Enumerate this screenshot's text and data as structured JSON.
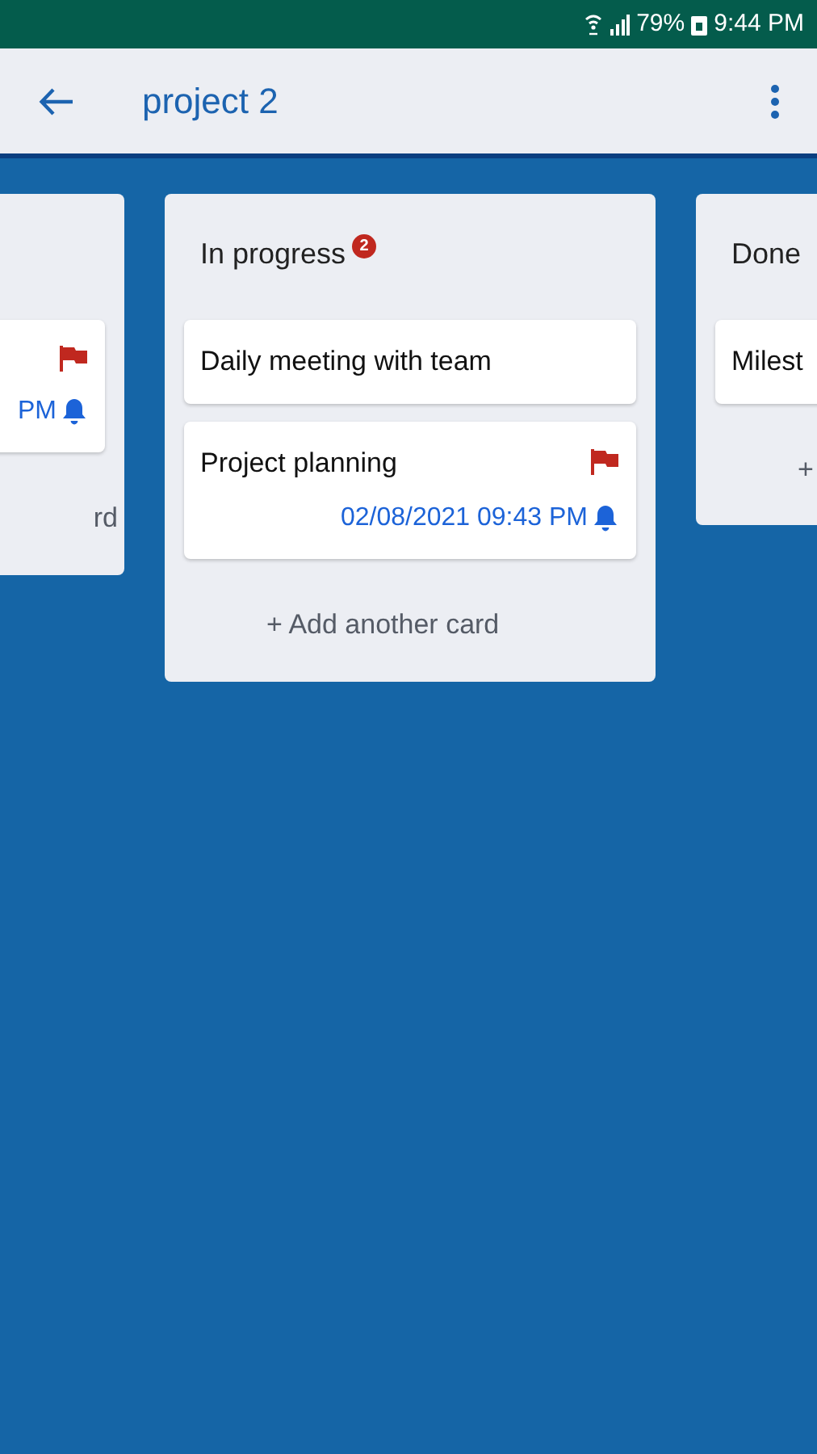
{
  "status_bar": {
    "battery": "79%",
    "time": "9:44 PM"
  },
  "app_bar": {
    "title": "project 2"
  },
  "columns": [
    {
      "cards": [
        {
          "flagged": true,
          "reminder": "PM"
        }
      ],
      "add_label": "rd"
    },
    {
      "title": "In progress",
      "badge": "2",
      "cards": [
        {
          "title": "Daily meeting with team",
          "flagged": false
        },
        {
          "title": "Project planning",
          "flagged": true,
          "reminder": "02/08/2021 09:43 PM"
        }
      ],
      "add_label": "+ Add another card"
    },
    {
      "title": "Done",
      "cards": [
        {
          "title": "Milest"
        }
      ],
      "add_label": "+"
    }
  ]
}
